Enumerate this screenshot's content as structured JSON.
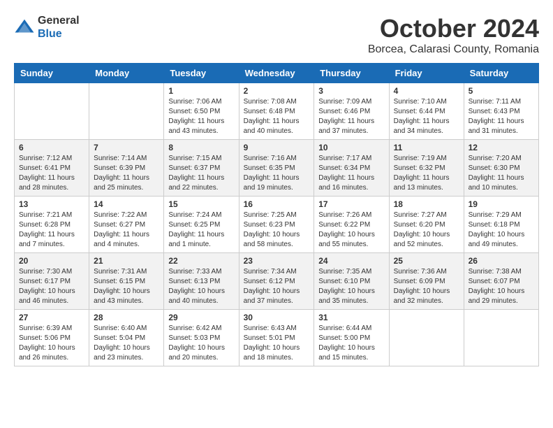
{
  "logo": {
    "general": "General",
    "blue": "Blue"
  },
  "title": "October 2024",
  "location": "Borcea, Calarasi County, Romania",
  "headers": [
    "Sunday",
    "Monday",
    "Tuesday",
    "Wednesday",
    "Thursday",
    "Friday",
    "Saturday"
  ],
  "weeks": [
    [
      {
        "day": "",
        "sunrise": "",
        "sunset": "",
        "daylight": ""
      },
      {
        "day": "",
        "sunrise": "",
        "sunset": "",
        "daylight": ""
      },
      {
        "day": "1",
        "sunrise": "Sunrise: 7:06 AM",
        "sunset": "Sunset: 6:50 PM",
        "daylight": "Daylight: 11 hours and 43 minutes."
      },
      {
        "day": "2",
        "sunrise": "Sunrise: 7:08 AM",
        "sunset": "Sunset: 6:48 PM",
        "daylight": "Daylight: 11 hours and 40 minutes."
      },
      {
        "day": "3",
        "sunrise": "Sunrise: 7:09 AM",
        "sunset": "Sunset: 6:46 PM",
        "daylight": "Daylight: 11 hours and 37 minutes."
      },
      {
        "day": "4",
        "sunrise": "Sunrise: 7:10 AM",
        "sunset": "Sunset: 6:44 PM",
        "daylight": "Daylight: 11 hours and 34 minutes."
      },
      {
        "day": "5",
        "sunrise": "Sunrise: 7:11 AM",
        "sunset": "Sunset: 6:43 PM",
        "daylight": "Daylight: 11 hours and 31 minutes."
      }
    ],
    [
      {
        "day": "6",
        "sunrise": "Sunrise: 7:12 AM",
        "sunset": "Sunset: 6:41 PM",
        "daylight": "Daylight: 11 hours and 28 minutes."
      },
      {
        "day": "7",
        "sunrise": "Sunrise: 7:14 AM",
        "sunset": "Sunset: 6:39 PM",
        "daylight": "Daylight: 11 hours and 25 minutes."
      },
      {
        "day": "8",
        "sunrise": "Sunrise: 7:15 AM",
        "sunset": "Sunset: 6:37 PM",
        "daylight": "Daylight: 11 hours and 22 minutes."
      },
      {
        "day": "9",
        "sunrise": "Sunrise: 7:16 AM",
        "sunset": "Sunset: 6:35 PM",
        "daylight": "Daylight: 11 hours and 19 minutes."
      },
      {
        "day": "10",
        "sunrise": "Sunrise: 7:17 AM",
        "sunset": "Sunset: 6:34 PM",
        "daylight": "Daylight: 11 hours and 16 minutes."
      },
      {
        "day": "11",
        "sunrise": "Sunrise: 7:19 AM",
        "sunset": "Sunset: 6:32 PM",
        "daylight": "Daylight: 11 hours and 13 minutes."
      },
      {
        "day": "12",
        "sunrise": "Sunrise: 7:20 AM",
        "sunset": "Sunset: 6:30 PM",
        "daylight": "Daylight: 11 hours and 10 minutes."
      }
    ],
    [
      {
        "day": "13",
        "sunrise": "Sunrise: 7:21 AM",
        "sunset": "Sunset: 6:28 PM",
        "daylight": "Daylight: 11 hours and 7 minutes."
      },
      {
        "day": "14",
        "sunrise": "Sunrise: 7:22 AM",
        "sunset": "Sunset: 6:27 PM",
        "daylight": "Daylight: 11 hours and 4 minutes."
      },
      {
        "day": "15",
        "sunrise": "Sunrise: 7:24 AM",
        "sunset": "Sunset: 6:25 PM",
        "daylight": "Daylight: 11 hours and 1 minute."
      },
      {
        "day": "16",
        "sunrise": "Sunrise: 7:25 AM",
        "sunset": "Sunset: 6:23 PM",
        "daylight": "Daylight: 10 hours and 58 minutes."
      },
      {
        "day": "17",
        "sunrise": "Sunrise: 7:26 AM",
        "sunset": "Sunset: 6:22 PM",
        "daylight": "Daylight: 10 hours and 55 minutes."
      },
      {
        "day": "18",
        "sunrise": "Sunrise: 7:27 AM",
        "sunset": "Sunset: 6:20 PM",
        "daylight": "Daylight: 10 hours and 52 minutes."
      },
      {
        "day": "19",
        "sunrise": "Sunrise: 7:29 AM",
        "sunset": "Sunset: 6:18 PM",
        "daylight": "Daylight: 10 hours and 49 minutes."
      }
    ],
    [
      {
        "day": "20",
        "sunrise": "Sunrise: 7:30 AM",
        "sunset": "Sunset: 6:17 PM",
        "daylight": "Daylight: 10 hours and 46 minutes."
      },
      {
        "day": "21",
        "sunrise": "Sunrise: 7:31 AM",
        "sunset": "Sunset: 6:15 PM",
        "daylight": "Daylight: 10 hours and 43 minutes."
      },
      {
        "day": "22",
        "sunrise": "Sunrise: 7:33 AM",
        "sunset": "Sunset: 6:13 PM",
        "daylight": "Daylight: 10 hours and 40 minutes."
      },
      {
        "day": "23",
        "sunrise": "Sunrise: 7:34 AM",
        "sunset": "Sunset: 6:12 PM",
        "daylight": "Daylight: 10 hours and 37 minutes."
      },
      {
        "day": "24",
        "sunrise": "Sunrise: 7:35 AM",
        "sunset": "Sunset: 6:10 PM",
        "daylight": "Daylight: 10 hours and 35 minutes."
      },
      {
        "day": "25",
        "sunrise": "Sunrise: 7:36 AM",
        "sunset": "Sunset: 6:09 PM",
        "daylight": "Daylight: 10 hours and 32 minutes."
      },
      {
        "day": "26",
        "sunrise": "Sunrise: 7:38 AM",
        "sunset": "Sunset: 6:07 PM",
        "daylight": "Daylight: 10 hours and 29 minutes."
      }
    ],
    [
      {
        "day": "27",
        "sunrise": "Sunrise: 6:39 AM",
        "sunset": "Sunset: 5:06 PM",
        "daylight": "Daylight: 10 hours and 26 minutes."
      },
      {
        "day": "28",
        "sunrise": "Sunrise: 6:40 AM",
        "sunset": "Sunset: 5:04 PM",
        "daylight": "Daylight: 10 hours and 23 minutes."
      },
      {
        "day": "29",
        "sunrise": "Sunrise: 6:42 AM",
        "sunset": "Sunset: 5:03 PM",
        "daylight": "Daylight: 10 hours and 20 minutes."
      },
      {
        "day": "30",
        "sunrise": "Sunrise: 6:43 AM",
        "sunset": "Sunset: 5:01 PM",
        "daylight": "Daylight: 10 hours and 18 minutes."
      },
      {
        "day": "31",
        "sunrise": "Sunrise: 6:44 AM",
        "sunset": "Sunset: 5:00 PM",
        "daylight": "Daylight: 10 hours and 15 minutes."
      },
      {
        "day": "",
        "sunrise": "",
        "sunset": "",
        "daylight": ""
      },
      {
        "day": "",
        "sunrise": "",
        "sunset": "",
        "daylight": ""
      }
    ]
  ]
}
